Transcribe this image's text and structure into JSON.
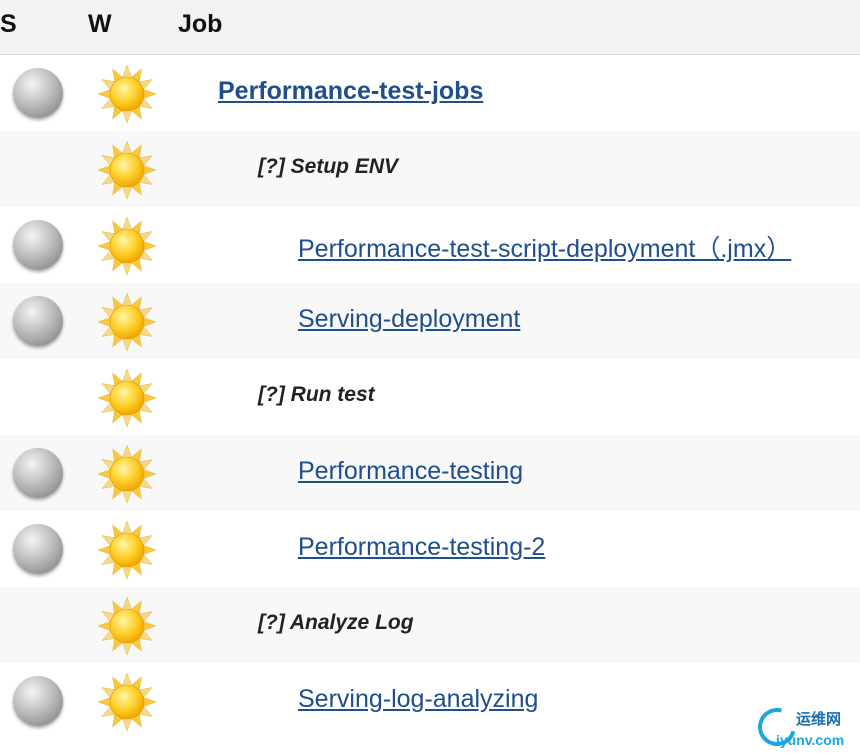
{
  "header": {
    "status_label": "S",
    "weather_label": "W",
    "job_label": "Job"
  },
  "rows": [
    {
      "type": "job",
      "level": "top",
      "name": "Performance-test-jobs",
      "status_icon": "grey-ball-icon",
      "weather_icon": "sunny-icon"
    },
    {
      "type": "section",
      "name": "[?] Setup ENV",
      "weather_icon": "sunny-icon"
    },
    {
      "type": "job",
      "level": "sub",
      "name": "Performance-test-script-deployment（.jmx）",
      "status_icon": "grey-ball-icon",
      "weather_icon": "sunny-icon"
    },
    {
      "type": "job",
      "level": "sub",
      "name": "Serving-deployment",
      "status_icon": "grey-ball-icon",
      "weather_icon": "sunny-icon"
    },
    {
      "type": "section",
      "name": "[?] Run test",
      "weather_icon": "sunny-icon"
    },
    {
      "type": "job",
      "level": "sub",
      "name": "Performance-testing",
      "status_icon": "grey-ball-icon",
      "weather_icon": "sunny-icon"
    },
    {
      "type": "job",
      "level": "sub",
      "name": "Performance-testing-2",
      "status_icon": "grey-ball-icon",
      "weather_icon": "sunny-icon"
    },
    {
      "type": "section",
      "name": "[?] Analyze Log",
      "weather_icon": "sunny-icon"
    },
    {
      "type": "job",
      "level": "sub",
      "name": "Serving-log-analyzing",
      "status_icon": "grey-ball-icon",
      "weather_icon": "sunny-icon"
    }
  ],
  "colors": {
    "link": "#1f4e8c",
    "header_bg": "#f2f2f2",
    "alt_row_bg": "#f8f8f8"
  },
  "watermark": {
    "cn_text": "运维网",
    "en_text": "iyunv.com"
  }
}
